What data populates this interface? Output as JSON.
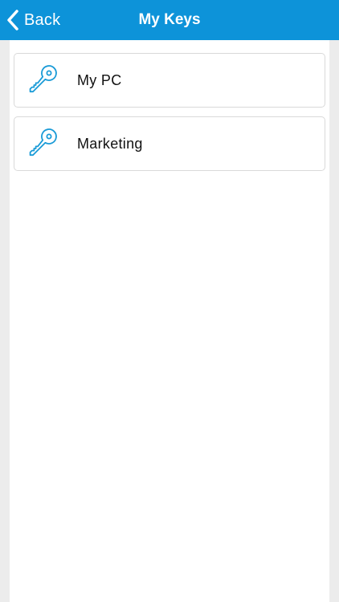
{
  "nav": {
    "back_label": "Back",
    "title": "My Keys"
  },
  "keys": [
    {
      "label": "My PC",
      "icon": "key-icon"
    },
    {
      "label": "Marketing",
      "icon": "key-icon"
    }
  ],
  "colors": {
    "nav_background": "#0d93d9",
    "nav_text": "#ffffff",
    "icon_accent": "#1a9bd7",
    "page_background": "#ececec",
    "card_border": "#d9d9d9"
  }
}
